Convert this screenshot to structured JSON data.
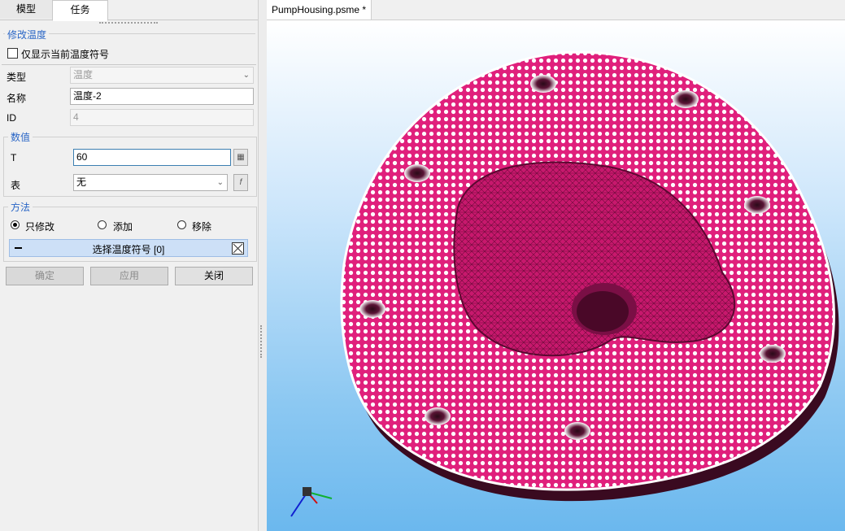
{
  "tabs": {
    "model": "模型",
    "task": "任务"
  },
  "section_modify": {
    "title": "修改温度",
    "only_current_label": "仅显示当前温度符号"
  },
  "fields": {
    "type_label": "类型",
    "type_value": "温度",
    "name_label": "名称",
    "name_value": "温度-2",
    "id_label": "ID",
    "id_value": "4"
  },
  "section_values": {
    "title": "数值",
    "t_label": "T",
    "t_value": "60",
    "table_label": "表",
    "table_value": "无"
  },
  "section_method": {
    "title": "方法",
    "options": [
      "只修改",
      "添加",
      "移除"
    ],
    "selected": "只修改",
    "select_bar_label": "选择温度符号 [0]"
  },
  "buttons": {
    "ok": "确定",
    "apply": "应用",
    "close": "关闭"
  },
  "document": {
    "tab_title": "PumpHousing.psme *"
  },
  "colors": {
    "accent": "#2a66c6",
    "mesh": "#e0207c",
    "viewport_top": "#ffffff",
    "viewport_bottom": "#6bb8ee"
  }
}
